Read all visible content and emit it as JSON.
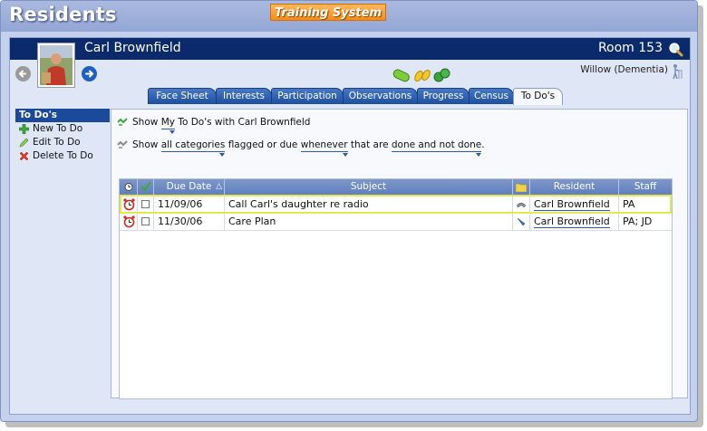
{
  "app": {
    "title": "Residents",
    "training_badge": "Training System"
  },
  "resident": {
    "name": "Carl Brownfield",
    "room": "Room 153",
    "unit": "Willow (Dementia)"
  },
  "tabs": [
    {
      "label": "Face Sheet",
      "active": false
    },
    {
      "label": "Interests",
      "active": false
    },
    {
      "label": "Participation",
      "active": false
    },
    {
      "label": "Observations",
      "active": false
    },
    {
      "label": "Progress",
      "active": false
    },
    {
      "label": "Census",
      "active": false
    },
    {
      "label": "To Do's",
      "active": true
    }
  ],
  "sidebar": {
    "title": "To Do's",
    "items": [
      {
        "label": "New To Do",
        "icon": "plus-icon"
      },
      {
        "label": "Edit To Do",
        "icon": "pencil-icon"
      },
      {
        "label": "Delete To Do",
        "icon": "delete-x-icon"
      }
    ]
  },
  "filters": {
    "line1": {
      "prefix": "Show",
      "owner": "My",
      "middle": "To Do's with Carl Brownfield"
    },
    "line2": {
      "prefix": "Show",
      "categories": "all categories",
      "mid1": "flagged or due",
      "when": "whenever",
      "mid2": "that are",
      "status": "done and not done",
      "suffix": "."
    }
  },
  "table": {
    "columns": {
      "due_date": "Due Date",
      "sort_indicator": "△",
      "subject": "Subject",
      "resident": "Resident",
      "staff": "Staff"
    },
    "rows": [
      {
        "due_date": "11/09/06",
        "subject": "Call Carl's daughter re radio",
        "type_icon": "phone-icon",
        "resident": "Carl Brownfield",
        "staff": "PA",
        "done": false
      },
      {
        "due_date": "11/30/06",
        "subject": "Care Plan",
        "type_icon": "pen-icon",
        "resident": "Carl Brownfield",
        "staff": "PA; JD",
        "done": false
      }
    ]
  },
  "colors": {
    "header_navy": "#0b2a6b",
    "tab_blue": "#2b5fb0",
    "badge_orange": "#f58c19",
    "selection_yellow": "#e7e84b"
  }
}
